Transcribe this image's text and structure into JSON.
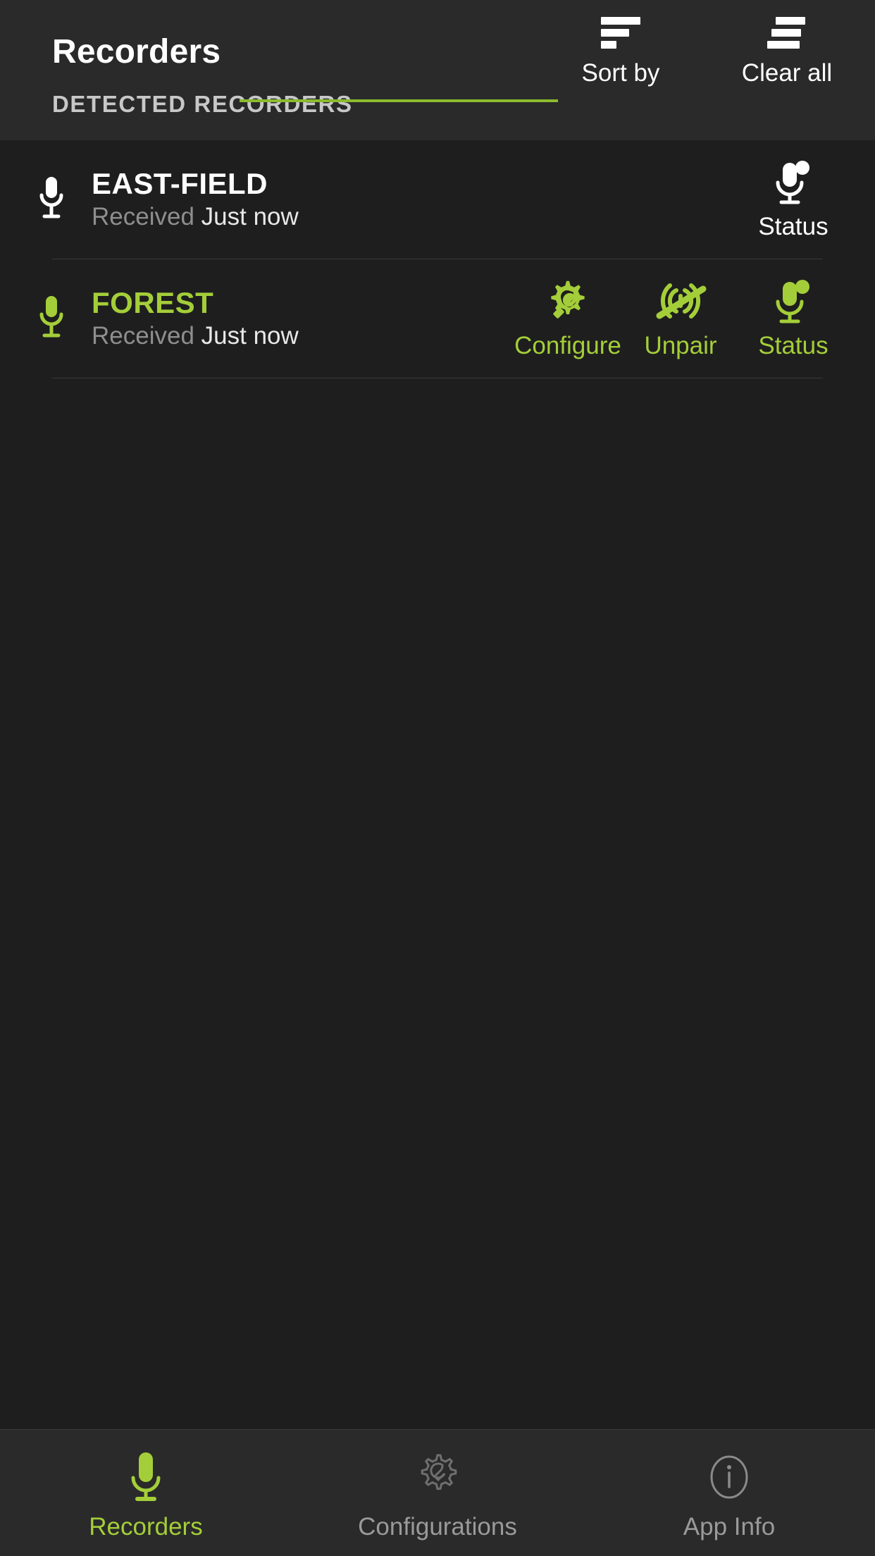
{
  "header": {
    "title": "Recorders",
    "section_label": "DETECTED RECORDERS",
    "actions": [
      {
        "label": "Sort by",
        "icon": "sort-icon"
      },
      {
        "label": "Clear all",
        "icon": "clear-all-icon"
      }
    ]
  },
  "colors": {
    "accent_green": "#a4ce39",
    "underline_green": "#8bbb2e",
    "header_bg": "#2a2a2a",
    "body_bg": "#1e1e1e",
    "nav_bg": "#2a2a2a",
    "muted_text": "#8e8e8e"
  },
  "recorders": [
    {
      "name": "EAST-FIELD",
      "received_label": "Received",
      "received_value": "Just now",
      "state": "unpaired",
      "mic_icon": "microphone-icon",
      "actions": [
        {
          "label": "Status",
          "icon": "microphone-status-icon"
        }
      ]
    },
    {
      "name": "FOREST",
      "received_label": "Received",
      "received_value": "Just now",
      "state": "paired",
      "mic_icon": "microphone-icon",
      "actions": [
        {
          "label": "Configure",
          "icon": "gear-wrench-icon"
        },
        {
          "label": "Unpair",
          "icon": "signal-off-icon"
        },
        {
          "label": "Status",
          "icon": "microphone-status-icon"
        }
      ]
    }
  ],
  "bottom_nav": {
    "items": [
      {
        "label": "Recorders",
        "icon": "microphone-icon",
        "active": true
      },
      {
        "label": "Configurations",
        "icon": "gear-wrench-outline-icon",
        "active": false
      },
      {
        "label": "App Info",
        "icon": "info-circle-icon",
        "active": false
      }
    ]
  }
}
